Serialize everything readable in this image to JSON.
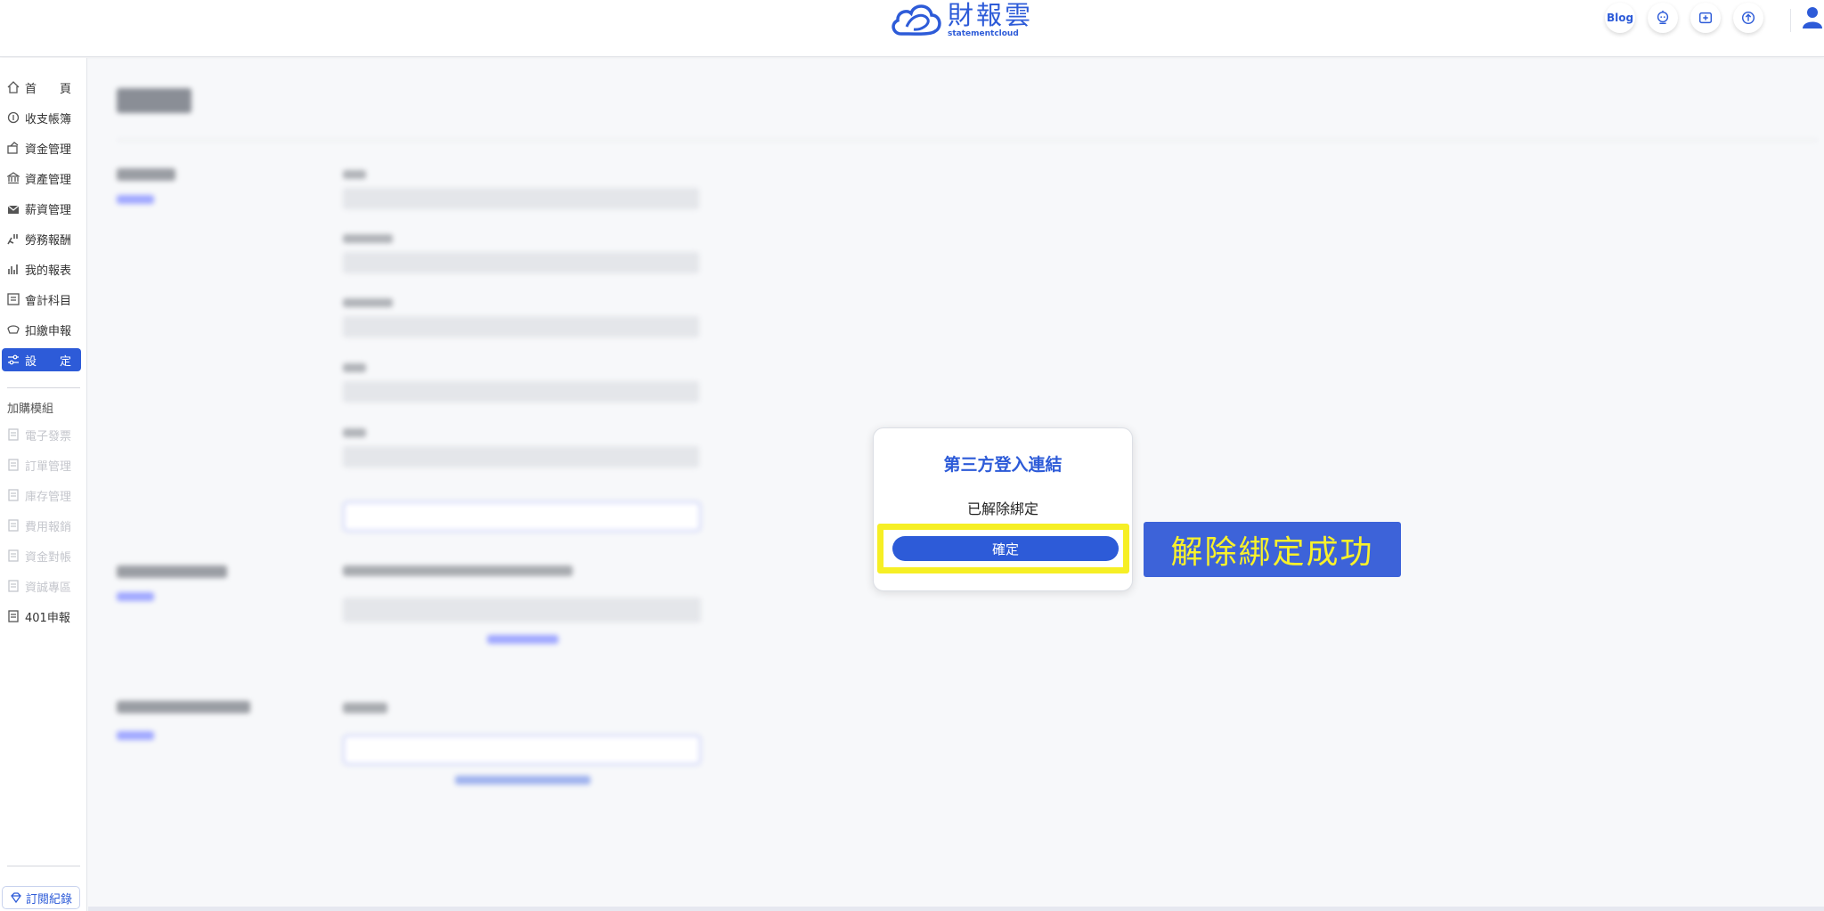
{
  "header": {
    "brand": "財報雲",
    "brand_sub": "statementcloud",
    "blog_label": "Blog",
    "icons": [
      "robot-help-icon",
      "tax-file-icon",
      "upload-chat-icon",
      "user-icon"
    ]
  },
  "sidebar": {
    "items": [
      {
        "label": "首　　頁",
        "icon": "home-icon"
      },
      {
        "label": "收支帳簿",
        "icon": "coin-book-icon"
      },
      {
        "label": "資金管理",
        "icon": "wallet-icon"
      },
      {
        "label": "資產管理",
        "icon": "bank-icon"
      },
      {
        "label": "薪資管理",
        "icon": "salary-envelope-icon"
      },
      {
        "label": "勞務報酬",
        "icon": "labor-icon"
      },
      {
        "label": "我的報表",
        "icon": "bar-chart-icon"
      },
      {
        "label": "會計科目",
        "icon": "ledger-icon"
      },
      {
        "label": "扣繳申報",
        "icon": "withholding-icon"
      },
      {
        "label": "設　　定",
        "icon": "settings-sliders-icon"
      }
    ],
    "addon_title": "加購模組",
    "addons": [
      {
        "label": "電子發票"
      },
      {
        "label": "訂單管理"
      },
      {
        "label": "庫存管理"
      },
      {
        "label": "費用報銷"
      },
      {
        "label": "資金對帳"
      },
      {
        "label": "資誠專區"
      },
      {
        "label": "401申報"
      }
    ],
    "subscription_label": "訂閱紀錄"
  },
  "dialog": {
    "title": "第三方登入連結",
    "message": "已解除綁定",
    "confirm_label": "確定"
  },
  "annotation": {
    "text": "解除綁定成功"
  },
  "colors": {
    "brand_blue": "#2d5bd8",
    "highlight_yellow": "#f6ef25",
    "annotation_bg": "#3d63d9",
    "annotation_text": "#f8f12b"
  }
}
